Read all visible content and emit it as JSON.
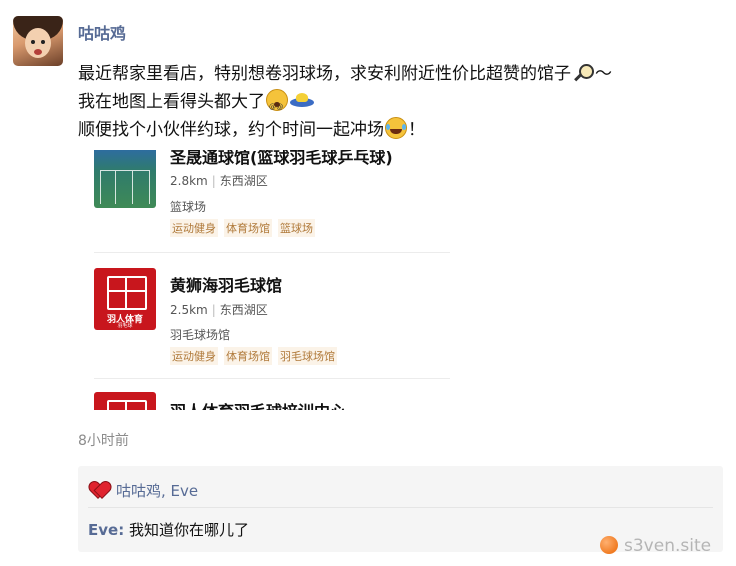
{
  "post": {
    "username": "咕咕鸡",
    "lines": [
      {
        "text": "最近帮家里看店，特别想卷羽球场，求安利附近性价比超赞的馆子",
        "trail": "～"
      },
      {
        "text": "我在地图上看得头都大了"
      },
      {
        "text": "顺便找个小伙伴约球，约个时间一起冲场",
        "trail": "！"
      }
    ],
    "emojis": [
      "search-emoji",
      "dizzy-face-emoji",
      "ufo-emoji",
      "laughing-tears-emoji"
    ]
  },
  "cards": [
    {
      "title": "圣晟通球馆(篮球羽毛球乒乓球)",
      "distance": "2.8km",
      "district": "东西湖区",
      "category": "篮球场",
      "tags": [
        "运动健身",
        "体育场馆",
        "篮球场"
      ],
      "thumb": "court-photo"
    },
    {
      "title": "黄狮海羽毛球馆",
      "distance": "2.5km",
      "district": "东西湖区",
      "category": "羽毛球场馆",
      "tags": [
        "运动健身",
        "体育场馆",
        "羽毛球场馆"
      ],
      "thumb": "red-logo",
      "logo_text": "羽人体育",
      "logo_sub": "羽毛球"
    },
    {
      "title": "羽人体育羽毛球培训中心",
      "thumb": "red-logo"
    }
  ],
  "timestamp": "8小时前",
  "interaction": {
    "likes": "咕咕鸡, Eve",
    "comment_author": "Eve:",
    "comment_text": "我知道你在哪儿了"
  },
  "watermark": "s3ven.site",
  "colors": {
    "link": "#576b95",
    "tag_text": "#b07a3a",
    "tag_bg": "#fbf3e8",
    "brand_red": "#c8161d"
  }
}
